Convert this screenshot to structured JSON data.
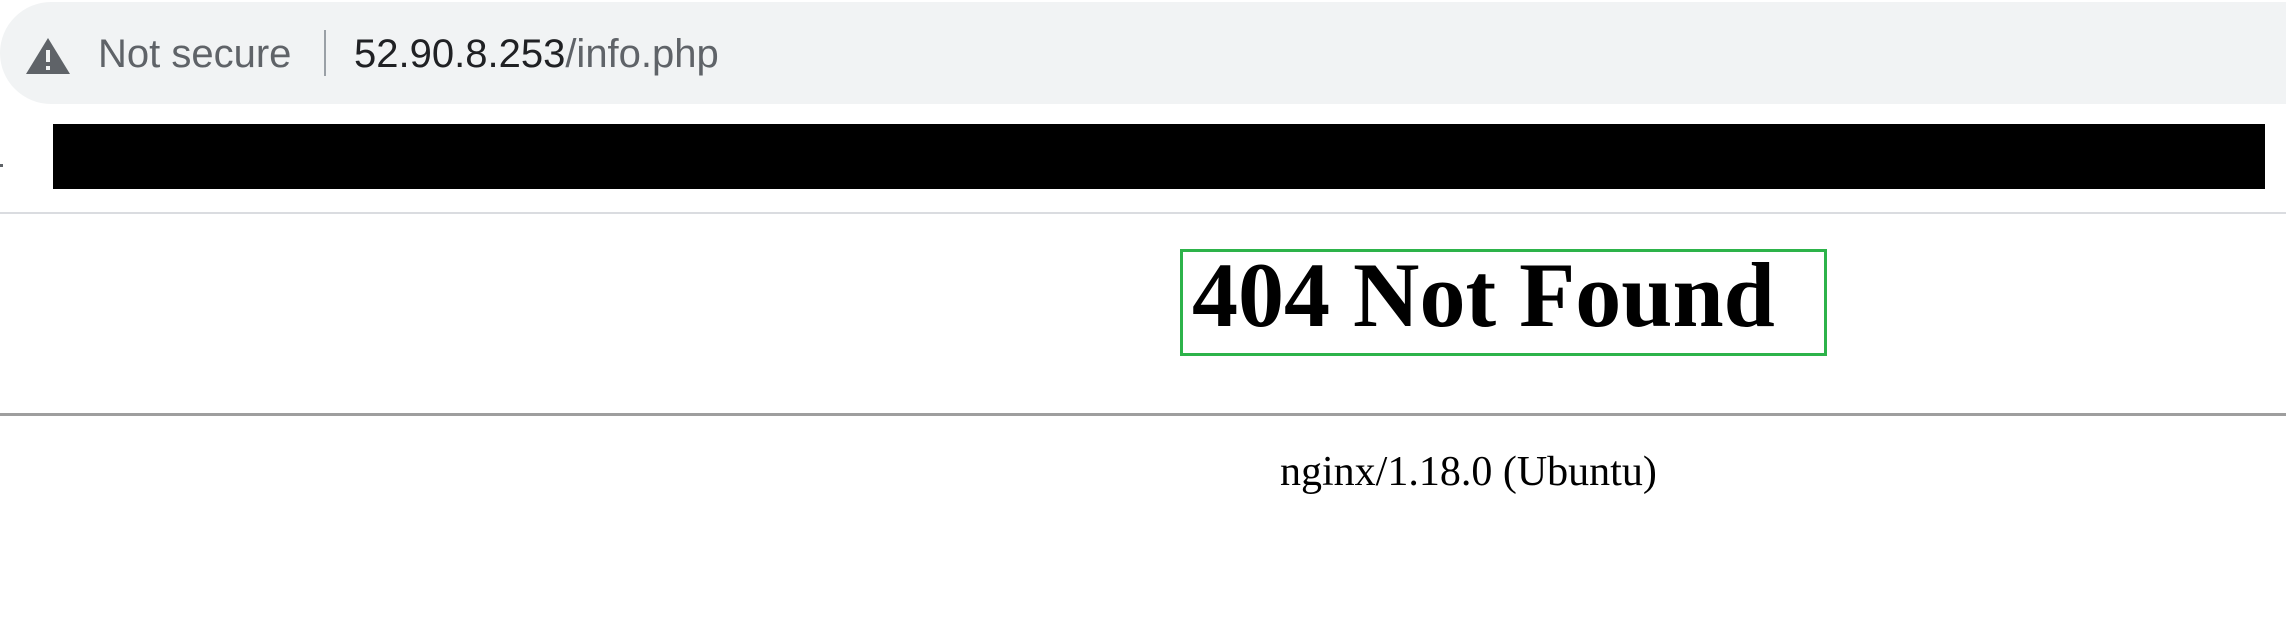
{
  "browser": {
    "security_icon": "warning-triangle-icon",
    "security_label": "Not secure",
    "url_host": "52.90.8.253",
    "url_path": "/info.php"
  },
  "page": {
    "title": "404 Not Found",
    "server_signature": "nginx/1.18.0 (Ubuntu)"
  },
  "colors": {
    "address_bar_bg": "#f1f3f4",
    "highlight_border": "#2db34a",
    "redaction": "#000000"
  }
}
